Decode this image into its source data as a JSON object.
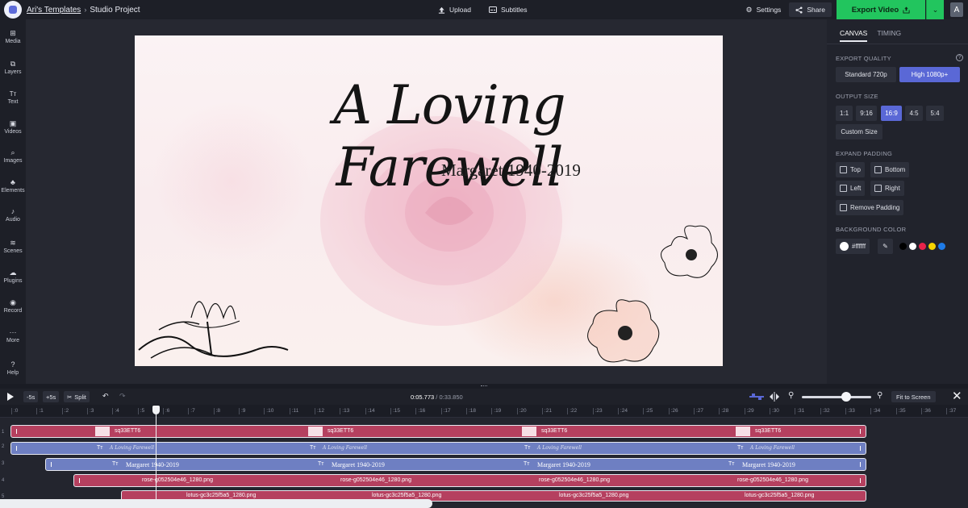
{
  "topbar": {
    "breadcrumb_link": "Ari's Templates",
    "breadcrumb_sep": "›",
    "project_name": "Studio Project",
    "upload_label": "Upload",
    "subtitles_label": "Subtitles",
    "settings_label": "Settings",
    "share_label": "Share",
    "export_label": "Export Video",
    "avatar_letter": "A"
  },
  "sidebar": {
    "items": [
      {
        "label": "Media",
        "icon": "media-icon"
      },
      {
        "label": "Layers",
        "icon": "layers-icon"
      },
      {
        "label": "Text",
        "icon": "text-icon"
      },
      {
        "label": "Videos",
        "icon": "videos-icon"
      },
      {
        "label": "Images",
        "icon": "images-icon"
      },
      {
        "label": "Elements",
        "icon": "elements-icon"
      },
      {
        "label": "Audio",
        "icon": "audio-icon"
      },
      {
        "label": "Scenes",
        "icon": "scenes-icon"
      },
      {
        "label": "Plugins",
        "icon": "plugins-icon"
      },
      {
        "label": "Record",
        "icon": "record-icon"
      },
      {
        "label": "More",
        "icon": "more-icon"
      },
      {
        "label": "Help",
        "icon": "help-icon"
      }
    ]
  },
  "canvas": {
    "title": "A Loving Farewell",
    "subtitle": "Margaret  1940-2019"
  },
  "panel": {
    "tabs": [
      "CANVAS",
      "TIMING"
    ],
    "export_quality_label": "EXPORT QUALITY",
    "quality_options": [
      "Standard 720p",
      "High 1080p+"
    ],
    "output_size_label": "OUTPUT SIZE",
    "size_options": [
      "1:1",
      "9:16",
      "16:9",
      "4:5",
      "5:4"
    ],
    "custom_size": "Custom Size",
    "expand_padding_label": "EXPAND PADDING",
    "padding_options": [
      "Top",
      "Bottom",
      "Left",
      "Right"
    ],
    "remove_padding": "Remove Padding",
    "background_color_label": "BACKGROUND COLOR",
    "background_hex": "#ffffff",
    "swatches": [
      "#000000",
      "#ffffff",
      "#e8234a",
      "#f5d400",
      "#1e7be8"
    ]
  },
  "timeline": {
    "minus_label": "-5s",
    "plus_label": "+5s",
    "split_label": "Split",
    "current_time": "0:05.773",
    "time_sep": " / ",
    "duration": "0:33.850",
    "fit_label": "Fit to Screen",
    "ruler_marks": [
      ":0",
      ":1",
      ":2",
      ":3",
      ":4",
      ":5",
      ":6",
      ":7",
      ":8",
      ":9",
      ":10",
      ":11",
      ":12",
      ":13",
      ":14",
      ":15",
      ":16",
      ":17",
      ":18",
      ":19",
      ":20",
      ":21",
      ":22",
      ":23",
      ":24",
      ":25",
      ":26",
      ":27",
      ":28",
      ":29",
      ":30",
      ":31",
      ":32",
      ":33",
      ":34",
      ":35",
      ":36",
      ":37"
    ],
    "track_numbers": [
      "1",
      "2",
      "3",
      "4",
      "5"
    ],
    "clip_labels": {
      "track1": "sq33ETT6",
      "track2": "A Loving Farewell",
      "track3": "Margaret 1940-2019",
      "track4": "rose-g052504e46_1280.png",
      "track5": "lotus-gc3c25f5a5_1280.png"
    }
  }
}
